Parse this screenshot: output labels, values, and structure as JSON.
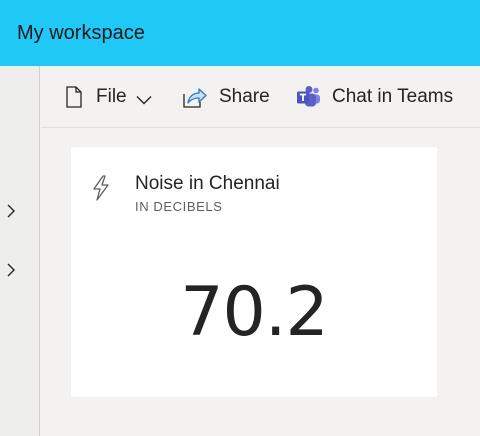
{
  "header": {
    "workspace_title": "My workspace",
    "background_color": "#20c8f6"
  },
  "left_rail": {
    "expanders": [
      {
        "icon": "chevron-right-icon"
      },
      {
        "icon": "chevron-right-icon"
      }
    ]
  },
  "toolbar": {
    "file_label": "File",
    "share_label": "Share",
    "teams_label": "Chat in Teams",
    "teams_color": "#5b5fc7"
  },
  "tile": {
    "title": "Noise in Chennai",
    "subtitle": "IN DECIBELS",
    "value": "70.2",
    "icon": "lightning-bolt-icon"
  }
}
